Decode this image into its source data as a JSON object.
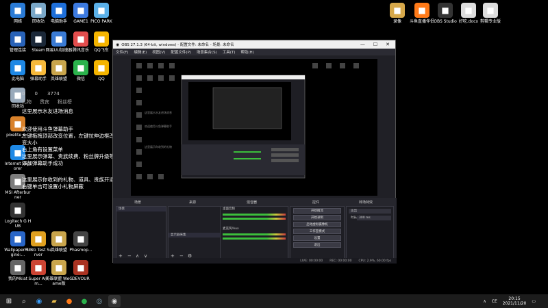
{
  "desktop_icons_left": [
    {
      "label": "网络",
      "icon": "network-icon",
      "color": "#2a7bd6"
    },
    {
      "label": "回收站",
      "icon": "recycle-bin-icon",
      "color": "#7aa7c7"
    },
    {
      "label": "电脑助手",
      "icon": "assistant-icon",
      "color": "#1e6fd9"
    },
    {
      "label": "GAME1",
      "icon": "game-icon",
      "color": "#3c7ae0"
    },
    {
      "label": "PICO PARK",
      "icon": "pico-park-icon",
      "color": "#5ab0e8"
    },
    {
      "label": "管理连接",
      "icon": "remote-icon",
      "color": "#2862b8"
    },
    {
      "label": "Steam",
      "icon": "steam-icon",
      "color": "#1b2838"
    },
    {
      "label": "网易UU加速器",
      "icon": "uu-icon",
      "color": "#3a7bd5"
    },
    {
      "label": "腾讯音乐",
      "icon": "music-icon",
      "color": "#e34d4d"
    },
    {
      "label": "QQ飞车",
      "icon": "qq-speed-icon",
      "color": "#f4b400"
    },
    {
      "label": "此电脑",
      "icon": "computer-icon",
      "color": "#1e88e5"
    },
    {
      "label": "弹幕助手",
      "icon": "danmaku-icon",
      "color": "#f6b93b"
    },
    {
      "label": "英雄联盟",
      "icon": "lol-icon",
      "color": "#c9a54c"
    },
    {
      "label": "微信",
      "icon": "wechat-icon",
      "color": "#2bb24c"
    },
    {
      "label": "QQ",
      "icon": "qq-icon",
      "color": "#f4b400"
    },
    {
      "label": "回收站",
      "icon": "recycle-bin-icon",
      "color": "#9ab"
    },
    {
      "label": "pixelite_s...",
      "icon": "archive-icon",
      "color": "#d9822b"
    },
    {
      "label": "Internet Explorer",
      "icon": "ie-icon",
      "color": "#1e88e5"
    },
    {
      "label": "MSI Afterburner",
      "icon": "msi-icon",
      "color": "#7c7c7c"
    },
    {
      "label": "Logitech G HUB",
      "icon": "logitech-icon",
      "color": "#333"
    },
    {
      "label": "Wallpaper Engine:...",
      "icon": "wallpaper-icon",
      "color": "#2966c8"
    },
    {
      "label": "PUBG Test Server",
      "icon": "pubg-icon",
      "color": "#e0a020"
    },
    {
      "label": "英雄联盟",
      "icon": "lol-icon",
      "color": "#c9a54c"
    },
    {
      "label": "Phasmop...",
      "icon": "phasmo-icon",
      "color": "#444"
    },
    {
      "label": "我的Mkiat",
      "icon": "file-icon",
      "color": "#666"
    },
    {
      "label": "Super Anim...",
      "icon": "anim-icon",
      "color": "#c43"
    },
    {
      "label": "英雄联盟 WeGame版",
      "icon": "lol-icon",
      "color": "#c9a54c"
    },
    {
      "label": "DEVOUR",
      "icon": "devour-icon",
      "color": "#a32"
    }
  ],
  "desktop_icons_right": [
    {
      "label": "录像",
      "icon": "folder-icon",
      "color": "#d6a84a"
    },
    {
      "label": "斗鱼直播伴侣",
      "icon": "douyu-icon",
      "color": "#ff7a18"
    },
    {
      "label": "OBS Studio",
      "icon": "obs-icon",
      "color": "#333"
    },
    {
      "label": "好吃.docx",
      "icon": "doc-icon",
      "color": "#ddd"
    },
    {
      "label": "剪辑专业版",
      "icon": "doc-icon",
      "color": "#ddd"
    }
  ],
  "overlay": {
    "stats": [
      "0",
      "0",
      "3774"
    ],
    "headers": [
      "礼物",
      "贵宾",
      "粉丝榜"
    ],
    "lines": [
      "这里展示水友进场消息",
      "欢迎使用斗鱼弹幕助手\n左键拖拽顶部改变位置，左键拉伸边框改变大小\n右上角有设置菜单\n这里展示弹幕、贵族续费、粉丝牌升级等\n添加弹幕助手成功",
      "这里展示你收到的礼物、道具、贵族开通\n右键单击可设置小礼物屏蔽"
    ]
  },
  "obs": {
    "title": "OBS 27.1.3 (64-bit, windows) - 配置文件: 未命名 - 场景: 未命名",
    "menu": [
      "文件(F)",
      "编辑(E)",
      "视图(V)",
      "配置文件(P)",
      "场景集合(S)",
      "工具(T)",
      "帮助(H)"
    ],
    "docks": {
      "scenes_title": "场景",
      "scenes": [
        "场景"
      ],
      "sources_title": "来源",
      "sources": [
        "显示器采集"
      ],
      "mixer_title": "混音器",
      "mixer": [
        "桌面音频",
        "麦克风/Aux"
      ],
      "controls_title": "控件",
      "controls": [
        "开始推流",
        "开始录制",
        "启动虚拟摄像机",
        "工作室模式",
        "设置",
        "退出"
      ],
      "transitions_title": "转场特效",
      "transition_value": "淡出",
      "duration_label": "时长",
      "duration_value": "300 ms",
      "no_source_tabs": [
        "属性",
        "滤镜"
      ],
      "no_source_label": "未选择来源"
    },
    "status": [
      "LIVE: 00:00:00",
      "REC: 00:00:00",
      "CPU: 2.9%, 60.00 fps"
    ]
  },
  "taskbar": {
    "apps": [
      "start-icon",
      "search-icon",
      "edge-icon",
      "folder-icon",
      "douyu-icon",
      "wechat-icon",
      "steam-icon",
      "obs-icon"
    ],
    "ime": "CE",
    "time": "20:15",
    "date": "2021/11/20"
  }
}
